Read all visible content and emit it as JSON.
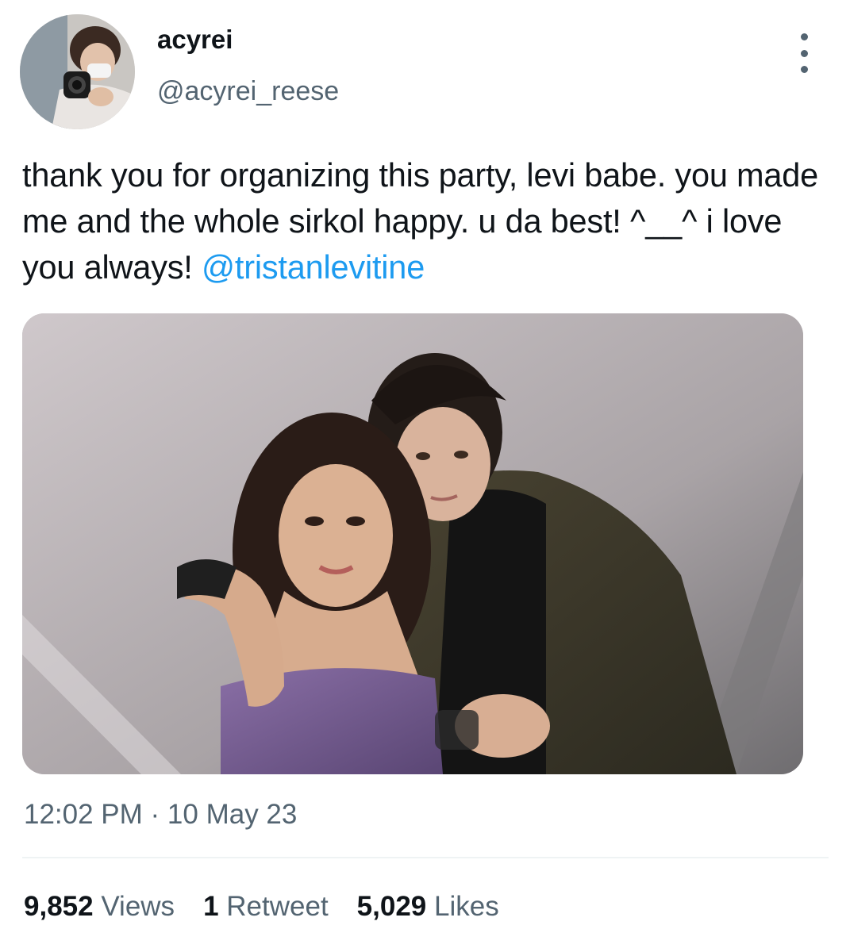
{
  "user": {
    "display_name": "acyrei",
    "handle": "@acyrei_reese"
  },
  "tweet": {
    "text": "thank you for organizing this party, levi babe. you made me and the whole sirkol happy. u da best! ^__^ i love you always! ",
    "mention": "@tristanlevitine",
    "timestamp": "12:02 PM · 10 May 23"
  },
  "stats": {
    "views_count": "9,852",
    "views_label": "Views",
    "retweets_count": "1",
    "retweets_label": "Retweet",
    "likes_count": "5,029",
    "likes_label": "Likes"
  },
  "colors": {
    "link": "#1d9bf0",
    "secondary_text": "#536471",
    "primary_text": "#0f1419",
    "divider": "#eff3f4"
  },
  "icons": {
    "more": "more-vertical-icon"
  }
}
